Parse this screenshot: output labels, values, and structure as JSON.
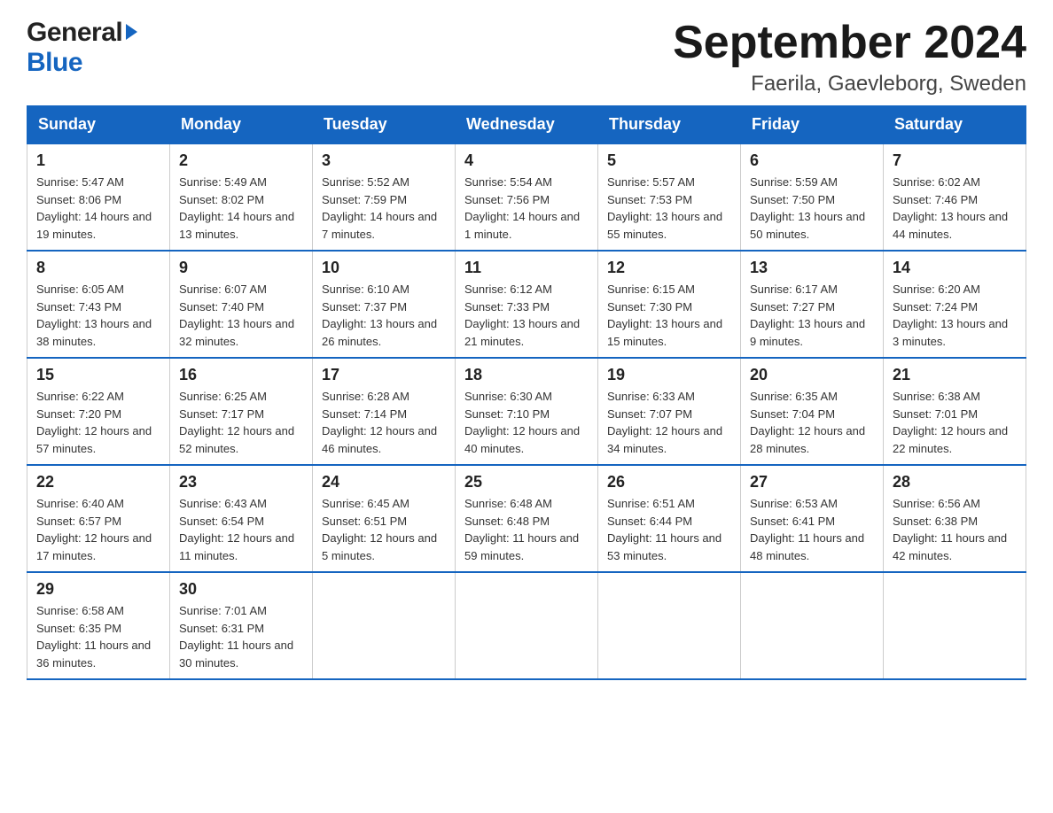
{
  "logo": {
    "line1": "General",
    "line2": "Blue"
  },
  "title": {
    "month": "September 2024",
    "location": "Faerila, Gaevleborg, Sweden"
  },
  "weekdays": [
    "Sunday",
    "Monday",
    "Tuesday",
    "Wednesday",
    "Thursday",
    "Friday",
    "Saturday"
  ],
  "weeks": [
    [
      {
        "day": "1",
        "sunrise": "5:47 AM",
        "sunset": "8:06 PM",
        "daylight": "14 hours and 19 minutes."
      },
      {
        "day": "2",
        "sunrise": "5:49 AM",
        "sunset": "8:02 PM",
        "daylight": "14 hours and 13 minutes."
      },
      {
        "day": "3",
        "sunrise": "5:52 AM",
        "sunset": "7:59 PM",
        "daylight": "14 hours and 7 minutes."
      },
      {
        "day": "4",
        "sunrise": "5:54 AM",
        "sunset": "7:56 PM",
        "daylight": "14 hours and 1 minute."
      },
      {
        "day": "5",
        "sunrise": "5:57 AM",
        "sunset": "7:53 PM",
        "daylight": "13 hours and 55 minutes."
      },
      {
        "day": "6",
        "sunrise": "5:59 AM",
        "sunset": "7:50 PM",
        "daylight": "13 hours and 50 minutes."
      },
      {
        "day": "7",
        "sunrise": "6:02 AM",
        "sunset": "7:46 PM",
        "daylight": "13 hours and 44 minutes."
      }
    ],
    [
      {
        "day": "8",
        "sunrise": "6:05 AM",
        "sunset": "7:43 PM",
        "daylight": "13 hours and 38 minutes."
      },
      {
        "day": "9",
        "sunrise": "6:07 AM",
        "sunset": "7:40 PM",
        "daylight": "13 hours and 32 minutes."
      },
      {
        "day": "10",
        "sunrise": "6:10 AM",
        "sunset": "7:37 PM",
        "daylight": "13 hours and 26 minutes."
      },
      {
        "day": "11",
        "sunrise": "6:12 AM",
        "sunset": "7:33 PM",
        "daylight": "13 hours and 21 minutes."
      },
      {
        "day": "12",
        "sunrise": "6:15 AM",
        "sunset": "7:30 PM",
        "daylight": "13 hours and 15 minutes."
      },
      {
        "day": "13",
        "sunrise": "6:17 AM",
        "sunset": "7:27 PM",
        "daylight": "13 hours and 9 minutes."
      },
      {
        "day": "14",
        "sunrise": "6:20 AM",
        "sunset": "7:24 PM",
        "daylight": "13 hours and 3 minutes."
      }
    ],
    [
      {
        "day": "15",
        "sunrise": "6:22 AM",
        "sunset": "7:20 PM",
        "daylight": "12 hours and 57 minutes."
      },
      {
        "day": "16",
        "sunrise": "6:25 AM",
        "sunset": "7:17 PM",
        "daylight": "12 hours and 52 minutes."
      },
      {
        "day": "17",
        "sunrise": "6:28 AM",
        "sunset": "7:14 PM",
        "daylight": "12 hours and 46 minutes."
      },
      {
        "day": "18",
        "sunrise": "6:30 AM",
        "sunset": "7:10 PM",
        "daylight": "12 hours and 40 minutes."
      },
      {
        "day": "19",
        "sunrise": "6:33 AM",
        "sunset": "7:07 PM",
        "daylight": "12 hours and 34 minutes."
      },
      {
        "day": "20",
        "sunrise": "6:35 AM",
        "sunset": "7:04 PM",
        "daylight": "12 hours and 28 minutes."
      },
      {
        "day": "21",
        "sunrise": "6:38 AM",
        "sunset": "7:01 PM",
        "daylight": "12 hours and 22 minutes."
      }
    ],
    [
      {
        "day": "22",
        "sunrise": "6:40 AM",
        "sunset": "6:57 PM",
        "daylight": "12 hours and 17 minutes."
      },
      {
        "day": "23",
        "sunrise": "6:43 AM",
        "sunset": "6:54 PM",
        "daylight": "12 hours and 11 minutes."
      },
      {
        "day": "24",
        "sunrise": "6:45 AM",
        "sunset": "6:51 PM",
        "daylight": "12 hours and 5 minutes."
      },
      {
        "day": "25",
        "sunrise": "6:48 AM",
        "sunset": "6:48 PM",
        "daylight": "11 hours and 59 minutes."
      },
      {
        "day": "26",
        "sunrise": "6:51 AM",
        "sunset": "6:44 PM",
        "daylight": "11 hours and 53 minutes."
      },
      {
        "day": "27",
        "sunrise": "6:53 AM",
        "sunset": "6:41 PM",
        "daylight": "11 hours and 48 minutes."
      },
      {
        "day": "28",
        "sunrise": "6:56 AM",
        "sunset": "6:38 PM",
        "daylight": "11 hours and 42 minutes."
      }
    ],
    [
      {
        "day": "29",
        "sunrise": "6:58 AM",
        "sunset": "6:35 PM",
        "daylight": "11 hours and 36 minutes."
      },
      {
        "day": "30",
        "sunrise": "7:01 AM",
        "sunset": "6:31 PM",
        "daylight": "11 hours and 30 minutes."
      },
      null,
      null,
      null,
      null,
      null
    ]
  ]
}
